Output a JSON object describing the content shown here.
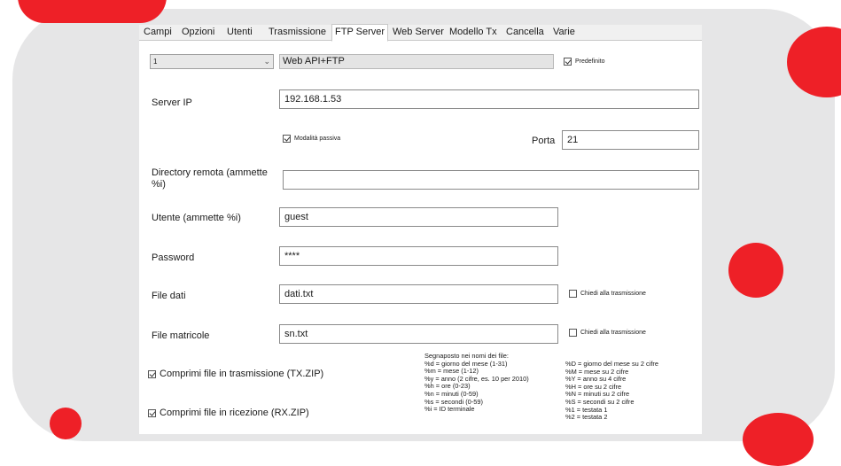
{
  "tabs": [
    "Campi",
    "Opzioni",
    "Utenti",
    "Trasmissione",
    "FTP Server",
    "Web Server",
    "Modello Tx",
    "Cancella",
    "Varie"
  ],
  "active_tab": "FTP Server",
  "profile": {
    "selected": "1",
    "mode": "Web API+FTP",
    "default_label": "Predefinito",
    "default_checked": true
  },
  "server_ip": {
    "label": "Server IP",
    "value": "192.168.1.53"
  },
  "passive": {
    "label": "Modalità passiva",
    "checked": true
  },
  "port": {
    "label": "Porta",
    "value": "21"
  },
  "remote_dir": {
    "label": "Directory remota (ammette %i)",
    "value": ""
  },
  "user": {
    "label": "Utente (ammette %i)",
    "value": "guest"
  },
  "password": {
    "label": "Password",
    "value": "****"
  },
  "data_file": {
    "label": "File dati",
    "value": "dati.txt",
    "ask_label": "Chiedi alla trasmissione",
    "ask_checked": false
  },
  "serial_file": {
    "label": "File matricole",
    "value": "sn.txt",
    "ask_label": "Chiedi alla trasmissione",
    "ask_checked": false
  },
  "compress_tx": {
    "label": "Comprimi file in trasmissione (TX.ZIP)",
    "checked": true
  },
  "compress_rx": {
    "label": "Comprimi file in ricezione (RX.ZIP)",
    "checked": true
  },
  "placeholders": {
    "title": "Segnaposto nei nomi dei file:",
    "left": [
      "%d = giorno del mese (1-31)",
      "%m = mese (1-12)",
      "%y = anno (2 cifre, es. 10 per 2010)",
      "%h = ore (0-23)",
      "%n = minuti (0-59)",
      "%s = secondi (0-59)",
      "%i = ID terminale"
    ],
    "right": [
      "%D = giorno del mese su 2 cifre",
      "%M = mese su 2 cifre",
      "%Y = anno su 4 cifre",
      "%H = ore su 2 cifre",
      "%N = minuti su 2 cifre",
      "%S = secondi su 2 cifre",
      "%1 = testata 1",
      "%2 = testata 2"
    ]
  },
  "colors": {
    "accent_red": "#ee2027",
    "panel_gray": "#e6e6e7"
  }
}
